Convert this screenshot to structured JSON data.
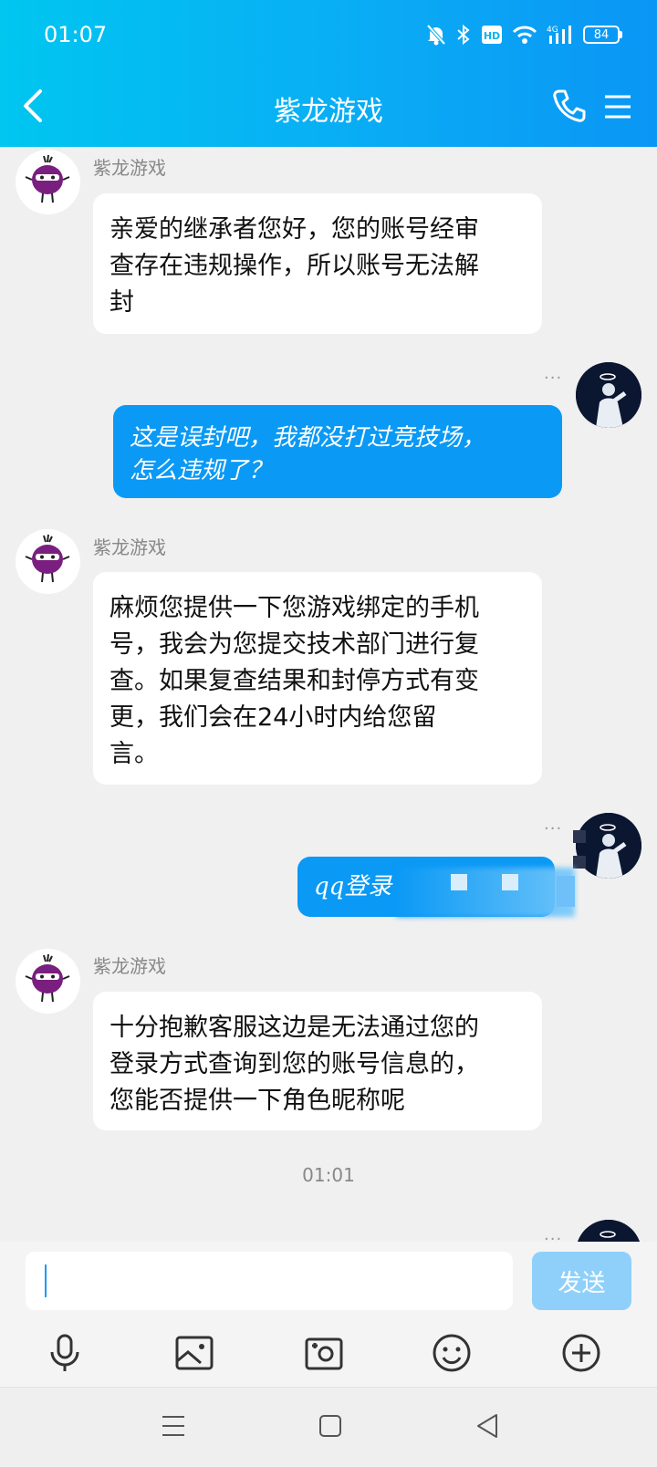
{
  "status_bar": {
    "time": "01:07",
    "network": "4G",
    "hd_label": "HD",
    "battery": "84",
    "icons": [
      "mute-icon",
      "bluetooth-icon",
      "hd-icon",
      "wifi-icon",
      "signal-icon",
      "battery-icon"
    ]
  },
  "header": {
    "title": "紫龙游戏",
    "back_icon": "chevron-left-icon",
    "call_icon": "phone-icon",
    "menu_icon": "menu-icon"
  },
  "messages": [
    {
      "from": "bot",
      "sender": "紫龙游戏",
      "lines": [
        "亲爱的继承者您好，您的账号经审",
        "查存在违规操作，所以账号无法解",
        "封"
      ]
    },
    {
      "from": "user",
      "lines": [
        "这是误封吧，我都没打过竞技场，",
        "怎么违规了？"
      ]
    },
    {
      "from": "bot",
      "sender": "紫龙游戏",
      "lines": [
        "麻烦您提供一下您游戏绑定的手机",
        "号，我会为您提交技术部门进行复",
        "查。如果复查结果和封停方式有变",
        "更，我们会在24小时内给您留",
        "言。"
      ]
    },
    {
      "from": "user",
      "lines": [
        "qq登录"
      ]
    },
    {
      "from": "bot",
      "sender": "紫龙游戏",
      "lines": [
        "十分抱歉客服这边是无法通过您的",
        "登录方式查询到您的账号信息的，",
        "您能否提供一下角色昵称呢"
      ]
    }
  ],
  "timestamp": "01:01",
  "more_dots": "···",
  "input": {
    "value": "",
    "placeholder": ""
  },
  "send_label": "发送",
  "toolbar": [
    "microphone-icon",
    "image-icon",
    "camera-icon",
    "emoji-icon",
    "plus-icon"
  ],
  "colors": {
    "accent": "#0a99f5",
    "header_start": "#00c6f0",
    "send_disabled": "#8fd0fb"
  }
}
